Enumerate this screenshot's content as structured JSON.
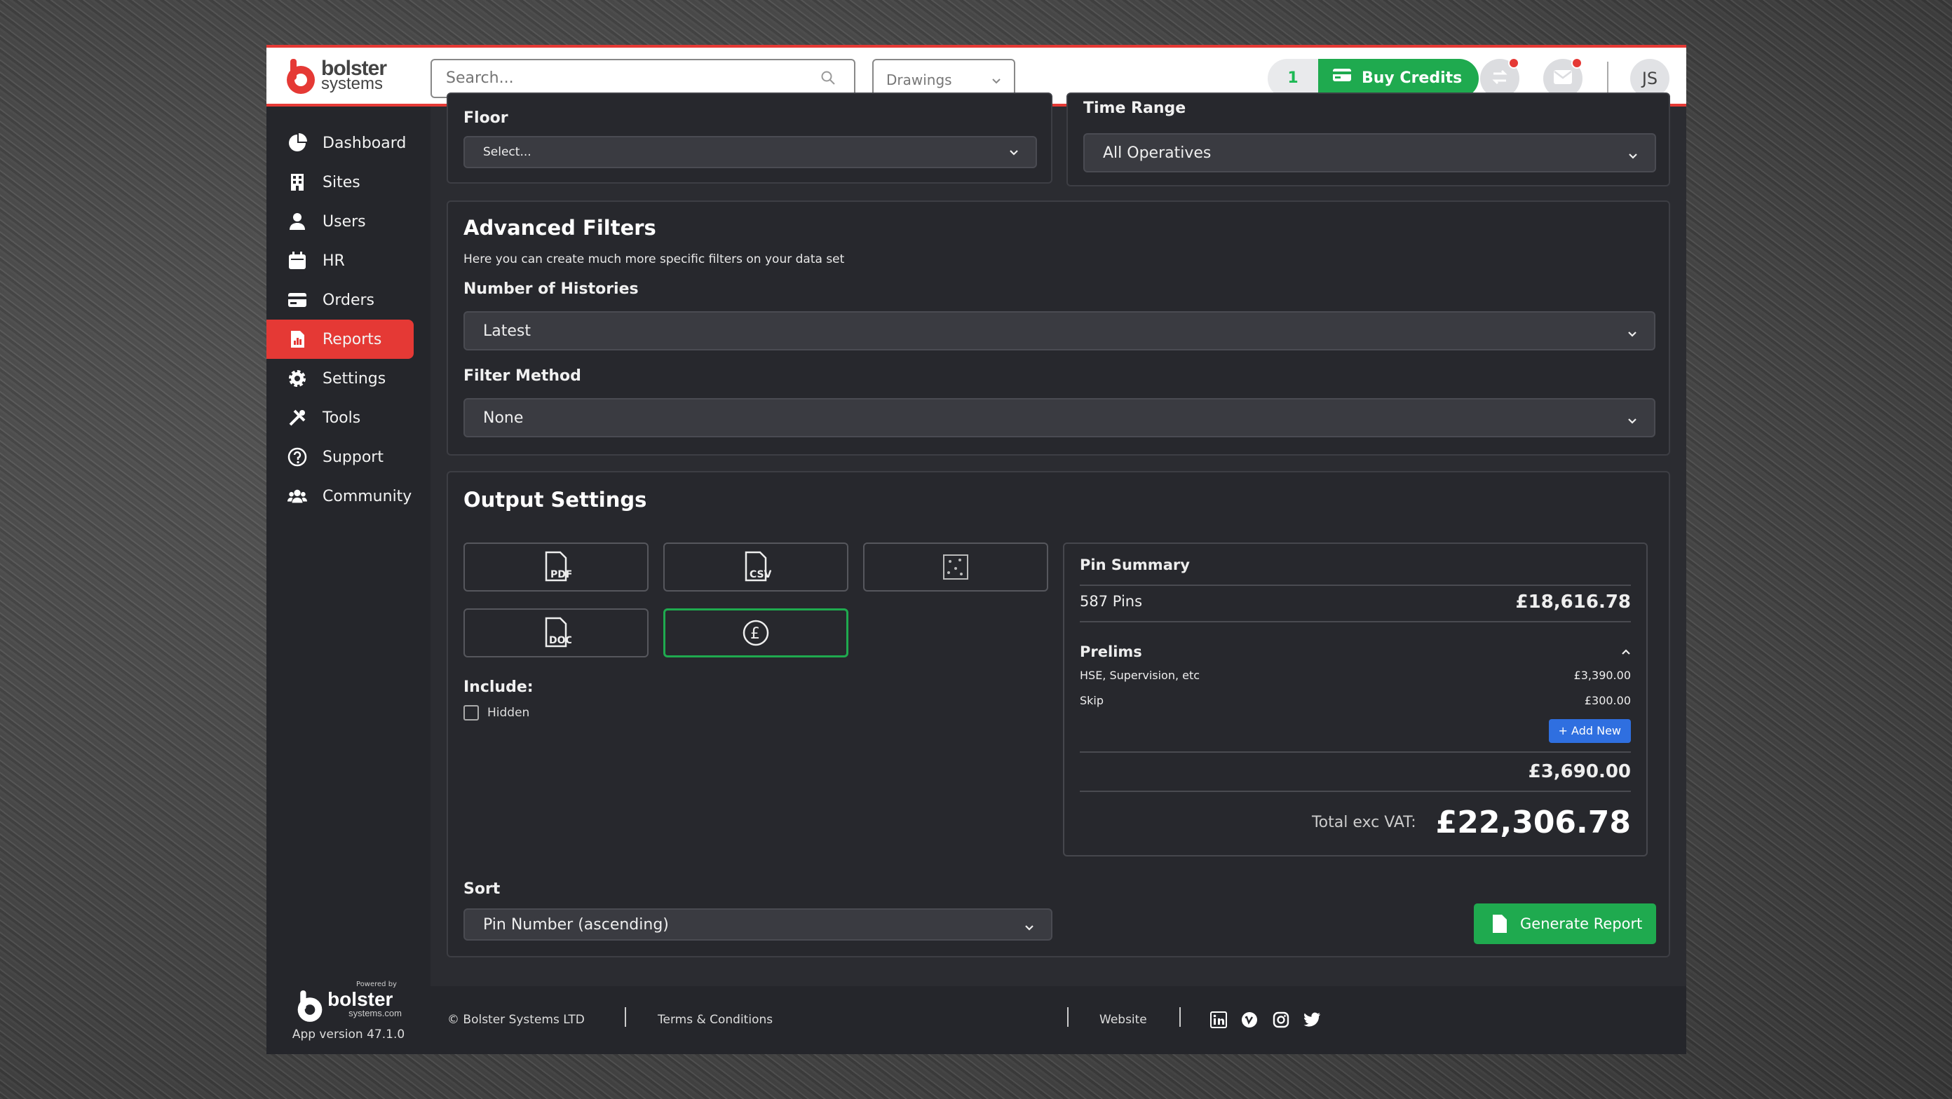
{
  "topbar": {
    "logo_line1": "bolster",
    "logo_line2": "systems",
    "search_placeholder": "Search...",
    "drawings_dropdown": "Drawings",
    "credits_count": "1",
    "buy_credits_label": "Buy Credits",
    "avatar_initials": "JS"
  },
  "sidebar": {
    "items": [
      {
        "label": "Dashboard",
        "icon": "pie-chart-icon"
      },
      {
        "label": "Sites",
        "icon": "building-icon"
      },
      {
        "label": "Users",
        "icon": "user-icon"
      },
      {
        "label": "HR",
        "icon": "calendar-icon"
      },
      {
        "label": "Orders",
        "icon": "card-icon"
      },
      {
        "label": "Reports",
        "icon": "report-icon",
        "active": true
      },
      {
        "label": "Settings",
        "icon": "gear-icon"
      },
      {
        "label": "Tools",
        "icon": "tools-icon"
      },
      {
        "label": "Support",
        "icon": "help-icon"
      },
      {
        "label": "Community",
        "icon": "community-icon"
      }
    ],
    "powered_by": "Powered by",
    "powered_name": "bolster",
    "powered_domain": "systems.com",
    "app_version": "App version 47.1.0"
  },
  "filters": {
    "floor_label": "Floor",
    "floor_value": "Select...",
    "time_range_label": "Time Range",
    "time_range_value": "All Operatives"
  },
  "advanced": {
    "title": "Advanced Filters",
    "subtitle": "Here you can create much more specific filters on your data set",
    "histories_label": "Number of Histories",
    "histories_value": "Latest",
    "method_label": "Filter Method",
    "method_value": "None"
  },
  "output": {
    "title": "Output Settings",
    "formats": [
      "PDF",
      "CSV",
      "DOC"
    ],
    "include_label": "Include:",
    "hidden_label": "Hidden",
    "sort_label": "Sort",
    "sort_value": "Pin Number (ascending)",
    "generate_label": "Generate Report"
  },
  "summary": {
    "title": "Pin Summary",
    "pins": "587 Pins",
    "pins_total": "£18,616.78",
    "prelims_title": "Prelims",
    "prelims": [
      {
        "name": "HSE, Supervision, etc",
        "amount": "£3,390.00"
      },
      {
        "name": "Skip",
        "amount": "£300.00"
      }
    ],
    "add_new": "+ Add New",
    "prelims_total": "£3,690.00",
    "total_label": "Total exc VAT:",
    "total_value": "£22,306.78"
  },
  "footer": {
    "copyright": "© Bolster Systems LTD",
    "terms": "Terms & Conditions",
    "website": "Website",
    "socials": [
      "linkedin-icon",
      "vimeo-icon",
      "instagram-icon",
      "twitter-icon"
    ]
  },
  "colors": {
    "accent": "#e53935",
    "green": "#1faa4f",
    "blue": "#2f6fe0",
    "bg": "#2b2c31"
  }
}
